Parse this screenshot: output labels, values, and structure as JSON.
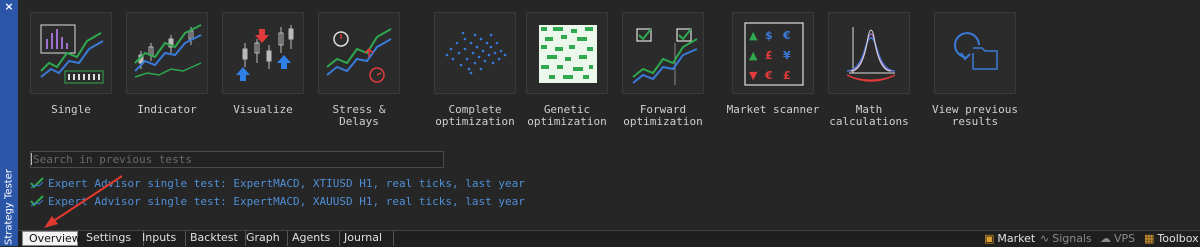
{
  "panel": {
    "title": "Strategy Tester",
    "close_glyph": "×"
  },
  "modes": [
    {
      "label": "Single",
      "icon": "single-test-icon"
    },
    {
      "label": "Indicator",
      "icon": "indicator-icon"
    },
    {
      "label": "Visualize",
      "icon": "visualize-icon"
    },
    {
      "label": "Stress &\nDelays",
      "icon": "stress-delays-icon"
    },
    {
      "label": "Complete\noptimization",
      "icon": "complete-optimization-icon"
    },
    {
      "label": "Genetic\noptimization",
      "icon": "genetic-optimization-icon"
    },
    {
      "label": "Forward\noptimization",
      "icon": "forward-optimization-icon"
    },
    {
      "label": "Market scanner",
      "icon": "market-scanner-icon"
    },
    {
      "label": "Math\ncalculations",
      "icon": "math-calculations-icon"
    },
    {
      "label": "View previous\nresults",
      "icon": "view-previous-results-icon"
    }
  ],
  "search": {
    "placeholder": "Search in previous tests",
    "value": ""
  },
  "recent_tests": [
    "Expert Advisor single test: ExpertMACD, XTIUSD H1, real ticks, last year",
    "Expert Advisor single test: ExpertMACD, XAUUSD H1, real ticks, last year"
  ],
  "tabs": [
    "Overview",
    "Settings",
    "Inputs",
    "Backtest",
    "Graph",
    "Agents",
    "Journal"
  ],
  "active_tab": "Overview",
  "bottom_links": [
    {
      "label": "Market",
      "icon": "market-bag-icon"
    },
    {
      "label": "Signals",
      "icon": "signals-icon"
    },
    {
      "label": "VPS",
      "icon": "vps-cloud-icon"
    },
    {
      "label": "Toolbox",
      "icon": "toolbox-icon"
    }
  ],
  "colors": {
    "strip": "#2b56a8",
    "link": "#4f8fd6",
    "annotation_arrow": "#e03a2f"
  }
}
